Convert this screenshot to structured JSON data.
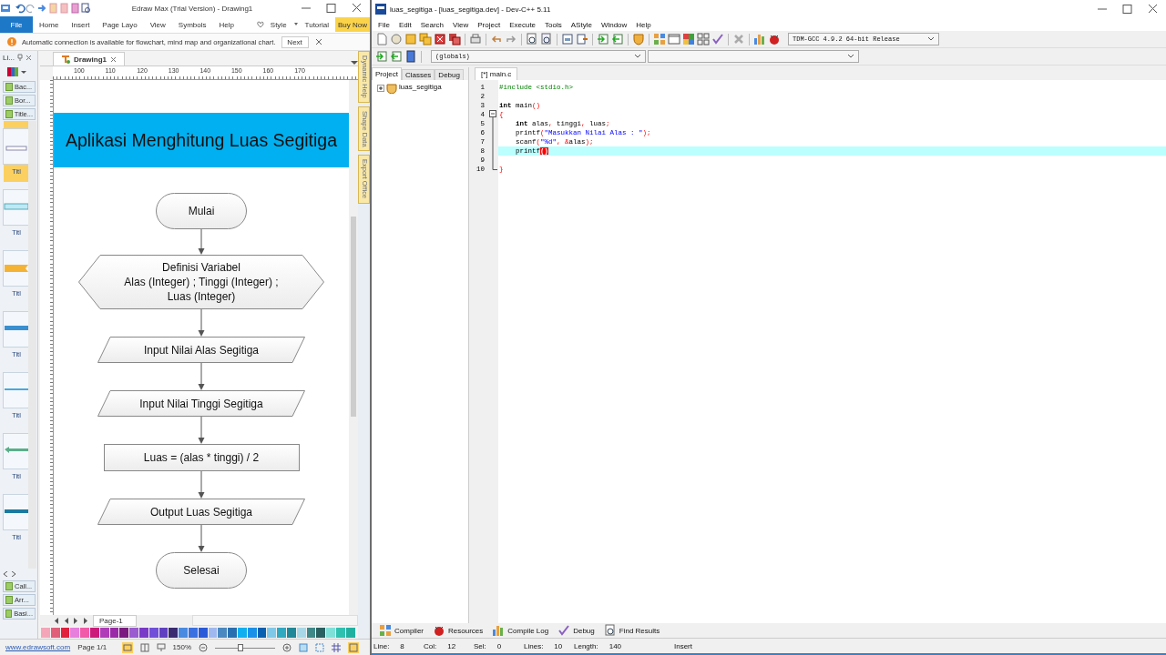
{
  "edraw": {
    "title": "Edraw Max (Trial Version) - Drawing1",
    "ribbon_tabs": [
      {
        "label": "File",
        "kind": "file"
      },
      {
        "label": "Home",
        "kind": "tab"
      },
      {
        "label": "Insert",
        "kind": "tab"
      },
      {
        "label": "Page Layo",
        "kind": "tab"
      },
      {
        "label": "View",
        "kind": "tab"
      },
      {
        "label": "Symbols",
        "kind": "tab"
      },
      {
        "label": "Help",
        "kind": "tab"
      }
    ],
    "ribbon_right": [
      {
        "label": "Style",
        "kind": "plain"
      },
      {
        "label": "Tutorial",
        "kind": "plain"
      },
      {
        "label": "Buy Now",
        "kind": "highlight"
      }
    ],
    "notice": {
      "text": "Automatic connection is available for flowchart, mind map and organizational chart.",
      "button": "Next"
    },
    "library": {
      "title": "Li...",
      "groups_top": [
        "Bac...",
        "Bor...",
        "Title..."
      ],
      "shapes": [
        {
          "label": "Titl",
          "selected": true
        },
        {
          "label": "Titl",
          "selected": false
        },
        {
          "label": "Titl",
          "selected": false
        },
        {
          "label": "Titl",
          "selected": false
        },
        {
          "label": "Titl",
          "selected": false
        },
        {
          "label": "Titl",
          "selected": false
        },
        {
          "label": "Titl",
          "selected": false
        }
      ],
      "groups_bottom": [
        "Call...",
        "Arr...",
        "Basi..."
      ]
    },
    "document_tab": "Drawing1",
    "ruler_labels": [
      "100",
      "110",
      "120",
      "130",
      "140",
      "150",
      "160",
      "170"
    ],
    "flowchart": {
      "title": "Aplikasi Menghitung Luas Segitiga",
      "nodes": [
        {
          "kind": "terminal",
          "lines": [
            "Mulai"
          ]
        },
        {
          "kind": "preparation",
          "lines": [
            "Definisi Variabel",
            "Alas (Integer) ; Tinggi (Integer) ;",
            "Luas (Integer)"
          ]
        },
        {
          "kind": "io",
          "lines": [
            "Input Nilai Alas Segitiga"
          ]
        },
        {
          "kind": "io",
          "lines": [
            "Input Nilai Tinggi Segitiga"
          ]
        },
        {
          "kind": "process",
          "lines": [
            "Luas = (alas * tinggi) / 2"
          ]
        },
        {
          "kind": "io",
          "lines": [
            "Output Luas Segitiga"
          ]
        },
        {
          "kind": "terminal",
          "lines": [
            "Selesai"
          ]
        }
      ]
    },
    "side_panels": [
      "Dynamic Help",
      "Shape Data",
      "Export Office"
    ],
    "page_tabs": [
      "Page-1"
    ],
    "palette": [
      {
        "color": "#f4a6b8"
      },
      {
        "color": "#e0607a"
      },
      {
        "color": "#e0203c"
      },
      {
        "color": "#e77fdd"
      },
      {
        "color": "#f05aa8"
      },
      {
        "color": "#cc1a7a"
      },
      {
        "color": "#b03cb8"
      },
      {
        "color": "#9a2aa8"
      },
      {
        "color": "#7b1a80"
      },
      {
        "color": "#9a5ad0"
      },
      {
        "color": "#7a3ac8"
      },
      {
        "color": "#7050d8"
      },
      {
        "color": "#6040c0"
      },
      {
        "color": "#3a2a70"
      },
      {
        "color": "#4a8ae0"
      },
      {
        "color": "#3a70e0"
      },
      {
        "color": "#2a5ad8"
      },
      {
        "color": "#a0b8f0"
      },
      {
        "color": "#4a88c0"
      },
      {
        "color": "#2a70b0"
      },
      {
        "color": "#10b0f0"
      },
      {
        "color": "#1a90e8"
      },
      {
        "color": "#0a60b0"
      },
      {
        "color": "#80c8e8"
      },
      {
        "color": "#30a8c0"
      },
      {
        "color": "#208898"
      },
      {
        "color": "#a8d8e8"
      },
      {
        "color": "#408888"
      },
      {
        "color": "#2a6060"
      },
      {
        "color": "#80e0d8"
      },
      {
        "color": "#30c0b0"
      },
      {
        "color": "#20b0a0"
      }
    ],
    "status": {
      "link": "www.edrawsoft.com",
      "page": "Page 1/1",
      "zoom": "150%",
      "zoom_slider": {
        "level": 0.42
      }
    }
  },
  "devcpp": {
    "title": "luas_segitiga - [luas_segitiga.dev] - Dev-C++ 5.11",
    "menu": [
      "File",
      "Edit",
      "Search",
      "View",
      "Project",
      "Execute",
      "Tools",
      "AStyle",
      "Window",
      "Help"
    ],
    "compiler": "TDM-GCC 4.9.2 64-bit Release",
    "scope": "(globals)",
    "panel_tabs": [
      {
        "label": "Project",
        "selected": true
      },
      {
        "label": "Classes",
        "selected": false
      },
      {
        "label": "Debug",
        "selected": false
      }
    ],
    "tree": [
      {
        "label": "luas_segitiga",
        "expanded": false
      }
    ],
    "editor_tabs": [
      {
        "label": "[*] main.c",
        "selected": true
      }
    ],
    "code": [
      {
        "number": "1",
        "current": false,
        "tokens": [
          {
            "kind": "pre",
            "text": "#include <stdio.h>"
          }
        ]
      },
      {
        "number": "2",
        "current": false
      },
      {
        "number": "3",
        "current": false,
        "tokens": [
          {
            "kind": "kw",
            "text": "int"
          },
          {
            "kind": "id",
            "text": " main"
          },
          {
            "kind": "sym",
            "text": "()"
          }
        ]
      },
      {
        "number": "4",
        "current": false,
        "tokens": [
          {
            "kind": "sym",
            "text": "{"
          }
        ]
      },
      {
        "number": "5",
        "current": false,
        "tokens": [
          {
            "kind": "kw",
            "text": "    int"
          },
          {
            "kind": "id",
            "text": " alas"
          },
          {
            "kind": "sym",
            "text": ","
          },
          {
            "kind": "id",
            "text": " tinggi"
          },
          {
            "kind": "sym",
            "text": ","
          },
          {
            "kind": "id",
            "text": " luas"
          },
          {
            "kind": "sym",
            "text": ";"
          }
        ]
      },
      {
        "number": "6",
        "current": false,
        "tokens": [
          {
            "kind": "id",
            "text": "    printf"
          },
          {
            "kind": "sym",
            "text": "("
          },
          {
            "kind": "str",
            "text": "\"Masukkan Nilai Alas : \""
          },
          {
            "kind": "sym",
            "text": ");"
          }
        ]
      },
      {
        "number": "7",
        "current": false,
        "tokens": [
          {
            "kind": "id",
            "text": "    scanf"
          },
          {
            "kind": "sym",
            "text": "("
          },
          {
            "kind": "str",
            "text": "\"%d\""
          },
          {
            "kind": "sym",
            "text": ","
          },
          {
            "kind": "sym",
            "text": " &"
          },
          {
            "kind": "id",
            "text": "alas"
          },
          {
            "kind": "sym",
            "text": ");"
          }
        ]
      },
      {
        "number": "8",
        "current": true,
        "tokens": [
          {
            "kind": "id",
            "text": "    printf"
          },
          {
            "kind": "match",
            "text": "()"
          }
        ]
      },
      {
        "number": "9",
        "current": false
      },
      {
        "number": "10",
        "current": false,
        "tokens": [
          {
            "kind": "sym",
            "text": "}"
          }
        ]
      }
    ],
    "bottom_tabs": [
      "Compiler",
      "Resources",
      "Compile Log",
      "Debug",
      "Find Results"
    ],
    "status": [
      {
        "label": "Line:",
        "value": "8"
      },
      {
        "label": "Col:",
        "value": "12"
      },
      {
        "label": "Sel:",
        "value": "0"
      },
      {
        "label": "Lines:",
        "value": "10"
      },
      {
        "label": "Length:",
        "value": "140"
      }
    ],
    "mode": "Insert"
  }
}
